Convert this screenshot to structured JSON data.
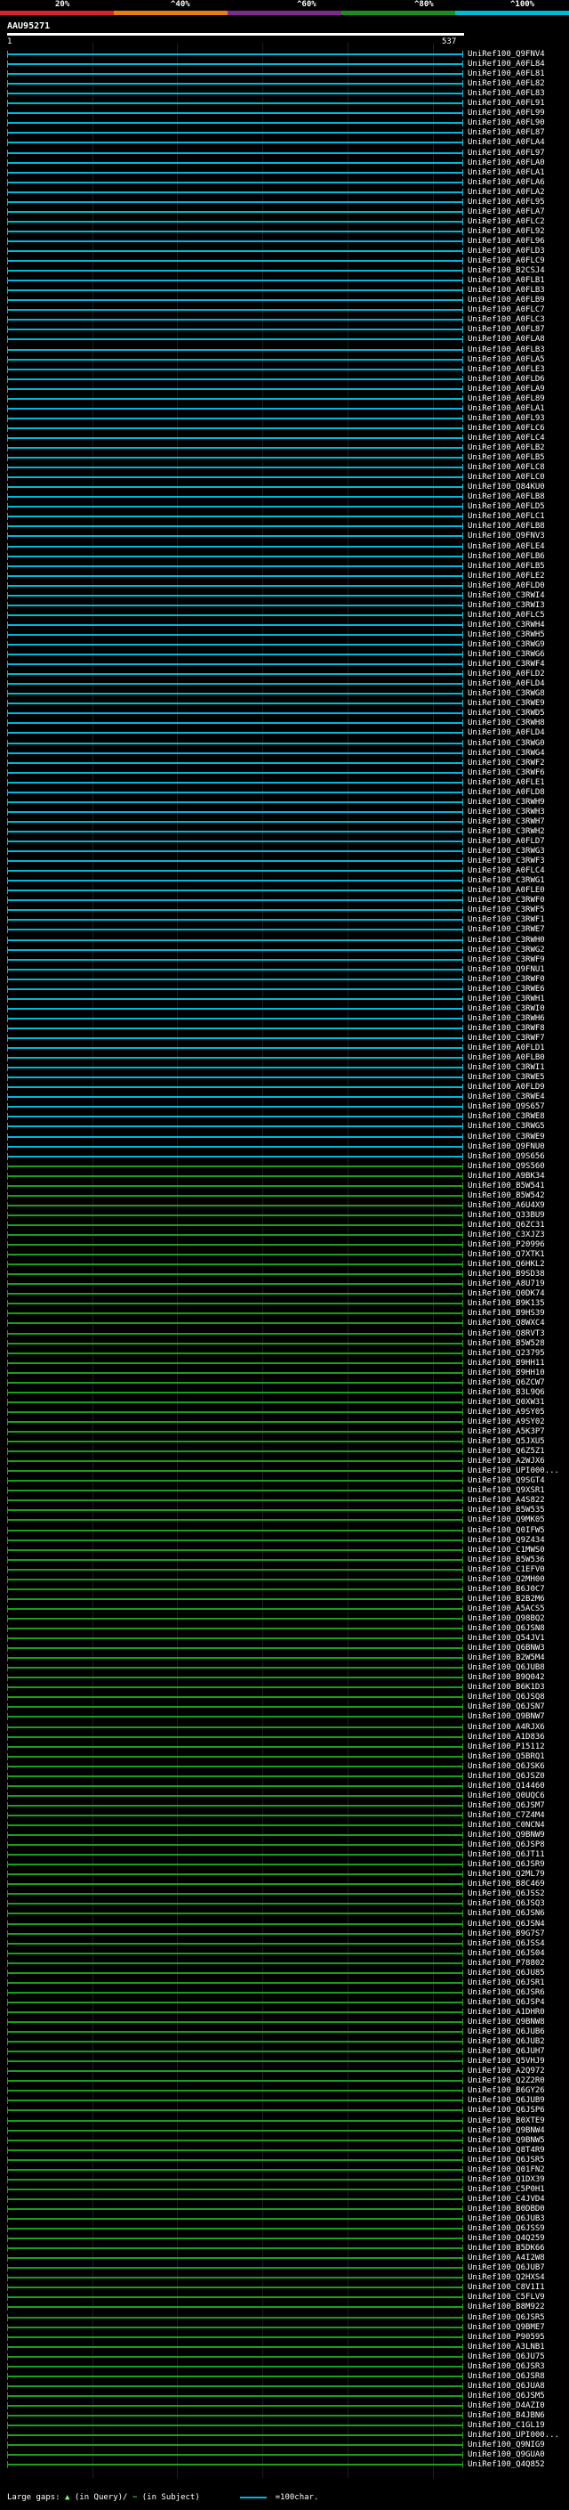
{
  "scale": {
    "labels": [
      "20%",
      "^40%",
      "^60%",
      "^80%",
      "^100%"
    ],
    "colors": [
      "#d8232a",
      "#e87c16",
      "#7d2a8f",
      "#1a8f1a",
      "#00b8d8"
    ]
  },
  "query": {
    "name": "AAU95271",
    "start": "1",
    "end": "537"
  },
  "footer": {
    "large_gaps_label": "Large gaps:",
    "in_query_label": "(in Query)/",
    "in_subject_label": "(in Subject)",
    "legend_label": "=100char."
  },
  "identity_colors": {
    "high": "#00b8d8",
    "mid": "#1a9f1a"
  },
  "hits": [
    {
      "name": "UniRef100_Q9FNV4",
      "c": "high"
    },
    {
      "name": "UniRef100_A0FL84",
      "c": "high"
    },
    {
      "name": "UniRef100_A0FL81",
      "c": "high"
    },
    {
      "name": "UniRef100_A0FL82",
      "c": "high"
    },
    {
      "name": "UniRef100_A0FL83",
      "c": "high"
    },
    {
      "name": "UniRef100_A0FL91",
      "c": "high"
    },
    {
      "name": "UniRef100_A0FL99",
      "c": "high"
    },
    {
      "name": "UniRef100_A0FL90",
      "c": "high"
    },
    {
      "name": "UniRef100_A0FL87",
      "c": "high"
    },
    {
      "name": "UniRef100_A0FLA4",
      "c": "high"
    },
    {
      "name": "UniRef100_A0FL97",
      "c": "high"
    },
    {
      "name": "UniRef100_A0FLA0",
      "c": "high"
    },
    {
      "name": "UniRef100_A0FLA1",
      "c": "high"
    },
    {
      "name": "UniRef100_A0FLA6",
      "c": "high"
    },
    {
      "name": "UniRef100_A0FLA2",
      "c": "high"
    },
    {
      "name": "UniRef100_A0FL95",
      "c": "high"
    },
    {
      "name": "UniRef100_A0FLA7",
      "c": "high"
    },
    {
      "name": "UniRef100_A0FLC2",
      "c": "high"
    },
    {
      "name": "UniRef100_A0FL92",
      "c": "high"
    },
    {
      "name": "UniRef100_A0FL96",
      "c": "high"
    },
    {
      "name": "UniRef100_A0FLD3",
      "c": "high"
    },
    {
      "name": "UniRef100_A0FLC9",
      "c": "high"
    },
    {
      "name": "UniRef100_B2CSJ4",
      "c": "high"
    },
    {
      "name": "UniRef100_A0FLB1",
      "c": "high"
    },
    {
      "name": "UniRef100_A0FLB3",
      "c": "high"
    },
    {
      "name": "UniRef100_A0FLB9",
      "c": "high"
    },
    {
      "name": "UniRef100_A0FLC7",
      "c": "high"
    },
    {
      "name": "UniRef100_A0FLC3",
      "c": "high"
    },
    {
      "name": "UniRef100_A0FL87",
      "c": "high"
    },
    {
      "name": "UniRef100_A0FLA8",
      "c": "high"
    },
    {
      "name": "UniRef100_A0FLB3",
      "c": "high"
    },
    {
      "name": "UniRef100_A0FLA5",
      "c": "high"
    },
    {
      "name": "UniRef100_A0FLE3",
      "c": "high"
    },
    {
      "name": "UniRef100_A0FLD6",
      "c": "high"
    },
    {
      "name": "UniRef100_A0FLA9",
      "c": "high"
    },
    {
      "name": "UniRef100_A0FL89",
      "c": "high"
    },
    {
      "name": "UniRef100_A0FLA1",
      "c": "high"
    },
    {
      "name": "UniRef100_A0FL93",
      "c": "high"
    },
    {
      "name": "UniRef100_A0FLC6",
      "c": "high"
    },
    {
      "name": "UniRef100_A0FLC4",
      "c": "high"
    },
    {
      "name": "UniRef100_A0FLB2",
      "c": "high"
    },
    {
      "name": "UniRef100_A0FLB5",
      "c": "high"
    },
    {
      "name": "UniRef100_A0FLC8",
      "c": "high"
    },
    {
      "name": "UniRef100_A0FLC0",
      "c": "high"
    },
    {
      "name": "UniRef100_Q84KU0",
      "c": "high"
    },
    {
      "name": "UniRef100_A0FLB8",
      "c": "high"
    },
    {
      "name": "UniRef100_A0FLD5",
      "c": "high"
    },
    {
      "name": "UniRef100_A0FLC1",
      "c": "high"
    },
    {
      "name": "UniRef100_A0FLB8",
      "c": "high"
    },
    {
      "name": "UniRef100_Q9FNV3",
      "c": "high"
    },
    {
      "name": "UniRef100_A0FLE4",
      "c": "high"
    },
    {
      "name": "UniRef100_A0FLB6",
      "c": "high"
    },
    {
      "name": "UniRef100_A0FLB5",
      "c": "high"
    },
    {
      "name": "UniRef100_A0FLE2",
      "c": "high"
    },
    {
      "name": "UniRef100_A0FLD0",
      "c": "high"
    },
    {
      "name": "UniRef100_C3RWI4",
      "c": "high"
    },
    {
      "name": "UniRef100_C3RWI3",
      "c": "high"
    },
    {
      "name": "UniRef100_A0FLC5",
      "c": "high"
    },
    {
      "name": "UniRef100_C3RWH4",
      "c": "high"
    },
    {
      "name": "UniRef100_C3RWH5",
      "c": "high"
    },
    {
      "name": "UniRef100_C3RWG9",
      "c": "high"
    },
    {
      "name": "UniRef100_C3RWG6",
      "c": "high"
    },
    {
      "name": "UniRef100_C3RWF4",
      "c": "high"
    },
    {
      "name": "UniRef100_A0FLD2",
      "c": "high"
    },
    {
      "name": "UniRef100_A0FLD4",
      "c": "high"
    },
    {
      "name": "UniRef100_C3RWG8",
      "c": "high"
    },
    {
      "name": "UniRef100_C3RWE9",
      "c": "high"
    },
    {
      "name": "UniRef100_C3RWD5",
      "c": "high"
    },
    {
      "name": "UniRef100_C3RWH8",
      "c": "high"
    },
    {
      "name": "UniRef100_A0FLD4",
      "c": "high"
    },
    {
      "name": "UniRef100_C3RWG0",
      "c": "high"
    },
    {
      "name": "UniRef100_C3RWG4",
      "c": "high"
    },
    {
      "name": "UniRef100_C3RWF2",
      "c": "high"
    },
    {
      "name": "UniRef100_C3RWF6",
      "c": "high"
    },
    {
      "name": "UniRef100_A0FLE1",
      "c": "high"
    },
    {
      "name": "UniRef100_A0FLD8",
      "c": "high"
    },
    {
      "name": "UniRef100_C3RWH9",
      "c": "high"
    },
    {
      "name": "UniRef100_C3RWH3",
      "c": "high"
    },
    {
      "name": "UniRef100_C3RWH7",
      "c": "high"
    },
    {
      "name": "UniRef100_C3RWH2",
      "c": "high"
    },
    {
      "name": "UniRef100_A0FLD7",
      "c": "high"
    },
    {
      "name": "UniRef100_C3RWG3",
      "c": "high"
    },
    {
      "name": "UniRef100_C3RWF3",
      "c": "high"
    },
    {
      "name": "UniRef100_A0FLC4",
      "c": "high"
    },
    {
      "name": "UniRef100_C3RWG1",
      "c": "high"
    },
    {
      "name": "UniRef100_A0FLE0",
      "c": "high"
    },
    {
      "name": "UniRef100_C3RWF0",
      "c": "high"
    },
    {
      "name": "UniRef100_C3RWF5",
      "c": "high"
    },
    {
      "name": "UniRef100_C3RWF1",
      "c": "high"
    },
    {
      "name": "UniRef100_C3RWE7",
      "c": "high"
    },
    {
      "name": "UniRef100_C3RWH0",
      "c": "high"
    },
    {
      "name": "UniRef100_C3RWG2",
      "c": "high"
    },
    {
      "name": "UniRef100_C3RWF9",
      "c": "high"
    },
    {
      "name": "UniRef100_Q9FNU1",
      "c": "high"
    },
    {
      "name": "UniRef100_C3RWF0",
      "c": "high"
    },
    {
      "name": "UniRef100_C3RWE6",
      "c": "high"
    },
    {
      "name": "UniRef100_C3RWH1",
      "c": "high"
    },
    {
      "name": "UniRef100_C3RWI0",
      "c": "high"
    },
    {
      "name": "UniRef100_C3RWH6",
      "c": "high"
    },
    {
      "name": "UniRef100_C3RWF8",
      "c": "high"
    },
    {
      "name": "UniRef100_C3RWF7",
      "c": "high"
    },
    {
      "name": "UniRef100_A0FLD1",
      "c": "high"
    },
    {
      "name": "UniRef100_A0FLB0",
      "c": "high"
    },
    {
      "name": "UniRef100_C3RWI1",
      "c": "high"
    },
    {
      "name": "UniRef100_C3RWE5",
      "c": "high"
    },
    {
      "name": "UniRef100_A0FLD9",
      "c": "high"
    },
    {
      "name": "UniRef100_C3RWE4",
      "c": "high"
    },
    {
      "name": "UniRef100_Q9S657",
      "c": "high"
    },
    {
      "name": "UniRef100_C3RWE8",
      "c": "high"
    },
    {
      "name": "UniRef100_C3RWG5",
      "c": "high"
    },
    {
      "name": "UniRef100_C3RWE9",
      "c": "high"
    },
    {
      "name": "UniRef100_Q9FNU0",
      "c": "high"
    },
    {
      "name": "UniRef100_Q9S656",
      "c": "high"
    },
    {
      "name": "UniRef100_Q9S560",
      "c": "mid"
    },
    {
      "name": "UniRef100_A9BK34",
      "c": "mid"
    },
    {
      "name": "UniRef100_B5W541",
      "c": "mid"
    },
    {
      "name": "UniRef100_B5W542",
      "c": "mid"
    },
    {
      "name": "UniRef100_A6U4X9",
      "c": "mid"
    },
    {
      "name": "UniRef100_Q33BU9",
      "c": "mid"
    },
    {
      "name": "UniRef100_Q6ZC31",
      "c": "mid"
    },
    {
      "name": "UniRef100_C3XJZ3",
      "c": "mid"
    },
    {
      "name": "UniRef100_P20996",
      "c": "mid"
    },
    {
      "name": "UniRef100_Q7XTK1",
      "c": "mid"
    },
    {
      "name": "UniRef100_Q6HKL2",
      "c": "mid"
    },
    {
      "name": "UniRef100_B9SD38",
      "c": "mid"
    },
    {
      "name": "UniRef100_A8U719",
      "c": "mid"
    },
    {
      "name": "UniRef100_Q0DK74",
      "c": "mid"
    },
    {
      "name": "UniRef100_B9K135",
      "c": "mid"
    },
    {
      "name": "UniRef100_B9HS39",
      "c": "mid"
    },
    {
      "name": "UniRef100_Q8WXC4",
      "c": "mid"
    },
    {
      "name": "UniRef100_Q8RVT3",
      "c": "mid"
    },
    {
      "name": "UniRef100_B5W528",
      "c": "mid"
    },
    {
      "name": "UniRef100_Q23795",
      "c": "mid"
    },
    {
      "name": "UniRef100_B9HH11",
      "c": "mid"
    },
    {
      "name": "UniRef100_B9HH10",
      "c": "mid"
    },
    {
      "name": "UniRef100_Q6ZCW7",
      "c": "mid"
    },
    {
      "name": "UniRef100_B3L9Q6",
      "c": "mid"
    },
    {
      "name": "UniRef100_Q0XW31",
      "c": "mid"
    },
    {
      "name": "UniRef100_A9SY05",
      "c": "mid"
    },
    {
      "name": "UniRef100_A9SY02",
      "c": "mid"
    },
    {
      "name": "UniRef100_A5K3P7",
      "c": "mid"
    },
    {
      "name": "UniRef100_Q5JXU5",
      "c": "mid"
    },
    {
      "name": "UniRef100_Q6Z5Z1",
      "c": "mid"
    },
    {
      "name": "UniRef100_A2WJX6",
      "c": "mid"
    },
    {
      "name": "UniRef100_UPI000...",
      "c": "mid"
    },
    {
      "name": "UniRef100_Q9SGT4",
      "c": "mid"
    },
    {
      "name": "UniRef100_Q9XSR1",
      "c": "mid"
    },
    {
      "name": "UniRef100_A4S822",
      "c": "mid"
    },
    {
      "name": "UniRef100_B5W535",
      "c": "mid"
    },
    {
      "name": "UniRef100_Q9MK05",
      "c": "mid"
    },
    {
      "name": "UniRef100_Q0IFW5",
      "c": "mid"
    },
    {
      "name": "UniRef100_Q9Z434",
      "c": "mid"
    },
    {
      "name": "UniRef100_C1MWS0",
      "c": "mid"
    },
    {
      "name": "UniRef100_B5W536",
      "c": "mid"
    },
    {
      "name": "UniRef100_C1EFV0",
      "c": "mid"
    },
    {
      "name": "UniRef100_Q2MH00",
      "c": "mid"
    },
    {
      "name": "UniRef100_B6J0C7",
      "c": "mid"
    },
    {
      "name": "UniRef100_B2B2M6",
      "c": "mid"
    },
    {
      "name": "UniRef100_A5ACS5",
      "c": "mid"
    },
    {
      "name": "UniRef100_Q98BQ2",
      "c": "mid"
    },
    {
      "name": "UniRef100_Q6JSN8",
      "c": "mid"
    },
    {
      "name": "UniRef100_Q54JV1",
      "c": "mid"
    },
    {
      "name": "UniRef100_Q6BNW3",
      "c": "mid"
    },
    {
      "name": "UniRef100_B2W5M4",
      "c": "mid"
    },
    {
      "name": "UniRef100_Q6JUB8",
      "c": "mid"
    },
    {
      "name": "UniRef100_B9Q042",
      "c": "mid"
    },
    {
      "name": "UniRef100_B6K1D3",
      "c": "mid"
    },
    {
      "name": "UniRef100_Q6JSQ8",
      "c": "mid"
    },
    {
      "name": "UniRef100_Q6JSN7",
      "c": "mid"
    },
    {
      "name": "UniRef100_Q9BNW7",
      "c": "mid"
    },
    {
      "name": "UniRef100_A4RJX6",
      "c": "mid"
    },
    {
      "name": "UniRef100_A1D836",
      "c": "mid"
    },
    {
      "name": "UniRef100_P15112",
      "c": "mid"
    },
    {
      "name": "UniRef100_Q5BRQ1",
      "c": "mid"
    },
    {
      "name": "UniRef100_Q6JSK6",
      "c": "mid"
    },
    {
      "name": "UniRef100_Q6JSZ0",
      "c": "mid"
    },
    {
      "name": "UniRef100_Q14460",
      "c": "mid"
    },
    {
      "name": "UniRef100_Q0UQC6",
      "c": "mid"
    },
    {
      "name": "UniRef100_Q6JSM7",
      "c": "mid"
    },
    {
      "name": "UniRef100_C7Z4M4",
      "c": "mid"
    },
    {
      "name": "UniRef100_C0NCN4",
      "c": "mid"
    },
    {
      "name": "UniRef100_Q9BNW9",
      "c": "mid"
    },
    {
      "name": "UniRef100_Q6JSP8",
      "c": "mid"
    },
    {
      "name": "UniRef100_Q6JT11",
      "c": "mid"
    },
    {
      "name": "UniRef100_Q6JSR9",
      "c": "mid"
    },
    {
      "name": "UniRef100_Q2ML79",
      "c": "mid"
    },
    {
      "name": "UniRef100_B8C469",
      "c": "mid"
    },
    {
      "name": "UniRef100_Q6JSS2",
      "c": "mid"
    },
    {
      "name": "UniRef100_Q6JSQ3",
      "c": "mid"
    },
    {
      "name": "UniRef100_Q6JSN6",
      "c": "mid"
    },
    {
      "name": "UniRef100_Q6JSN4",
      "c": "mid"
    },
    {
      "name": "UniRef100_B9G7S7",
      "c": "mid"
    },
    {
      "name": "UniRef100_Q6JSS4",
      "c": "mid"
    },
    {
      "name": "UniRef100_Q6JS04",
      "c": "mid"
    },
    {
      "name": "UniRef100_P78802",
      "c": "mid"
    },
    {
      "name": "UniRef100_Q6JU85",
      "c": "mid"
    },
    {
      "name": "UniRef100_Q6JSR1",
      "c": "mid"
    },
    {
      "name": "UniRef100_Q6JSR6",
      "c": "mid"
    },
    {
      "name": "UniRef100_Q6JSP4",
      "c": "mid"
    },
    {
      "name": "UniRef100_A1DHR0",
      "c": "mid"
    },
    {
      "name": "UniRef100_Q9BNW8",
      "c": "mid"
    },
    {
      "name": "UniRef100_Q6JUB6",
      "c": "mid"
    },
    {
      "name": "UniRef100_Q6JUB2",
      "c": "mid"
    },
    {
      "name": "UniRef100_Q6JUH7",
      "c": "mid"
    },
    {
      "name": "UniRef100_Q5VHJ9",
      "c": "mid"
    },
    {
      "name": "UniRef100_A2Q972",
      "c": "mid"
    },
    {
      "name": "UniRef100_Q2Z2R0",
      "c": "mid"
    },
    {
      "name": "UniRef100_B6GY26",
      "c": "mid"
    },
    {
      "name": "UniRef100_Q6JUB9",
      "c": "mid"
    },
    {
      "name": "UniRef100_Q6JSP6",
      "c": "mid"
    },
    {
      "name": "UniRef100_B0XTE9",
      "c": "mid"
    },
    {
      "name": "UniRef100_Q9BNW4",
      "c": "mid"
    },
    {
      "name": "UniRef100_Q9BNW5",
      "c": "mid"
    },
    {
      "name": "UniRef100_Q8T4R9",
      "c": "mid"
    },
    {
      "name": "UniRef100_Q6JSR5",
      "c": "mid"
    },
    {
      "name": "UniRef100_Q01FN2",
      "c": "mid"
    },
    {
      "name": "UniRef100_Q1DX39",
      "c": "mid"
    },
    {
      "name": "UniRef100_C5P0H1",
      "c": "mid"
    },
    {
      "name": "UniRef100_C4JVD4",
      "c": "mid"
    },
    {
      "name": "UniRef100_B0DBD0",
      "c": "mid"
    },
    {
      "name": "UniRef100_Q6JUB3",
      "c": "mid"
    },
    {
      "name": "UniRef100_Q6JSS9",
      "c": "mid"
    },
    {
      "name": "UniRef100_Q4Q259",
      "c": "mid"
    },
    {
      "name": "UniRef100_B5DK66",
      "c": "mid"
    },
    {
      "name": "UniRef100_A4I2W8",
      "c": "mid"
    },
    {
      "name": "UniRef100_Q6JUB7",
      "c": "mid"
    },
    {
      "name": "UniRef100_Q2HXS4",
      "c": "mid"
    },
    {
      "name": "UniRef100_C8V1I1",
      "c": "mid"
    },
    {
      "name": "UniRef100_C5FLV9",
      "c": "mid"
    },
    {
      "name": "UniRef100_B8M922",
      "c": "mid"
    },
    {
      "name": "UniRef100_Q6JSR5",
      "c": "mid"
    },
    {
      "name": "UniRef100_Q9BME7",
      "c": "mid"
    },
    {
      "name": "UniRef100_P90595",
      "c": "mid"
    },
    {
      "name": "UniRef100_A3LNB1",
      "c": "mid"
    },
    {
      "name": "UniRef100_Q6JU75",
      "c": "mid"
    },
    {
      "name": "UniRef100_Q6JSR3",
      "c": "mid"
    },
    {
      "name": "UniRef100_Q6JSR8",
      "c": "mid"
    },
    {
      "name": "UniRef100_Q6JUA8",
      "c": "mid"
    },
    {
      "name": "UniRef100_Q6JSM5",
      "c": "mid"
    },
    {
      "name": "UniRef100_D4AZI0",
      "c": "mid"
    },
    {
      "name": "UniRef100_B4JBN6",
      "c": "mid"
    },
    {
      "name": "UniRef100_C1GL19",
      "c": "mid"
    },
    {
      "name": "UniRef100_UPI000...",
      "c": "mid"
    },
    {
      "name": "UniRef100_Q9NIG9",
      "c": "mid"
    },
    {
      "name": "UniRef100_Q9GUA0",
      "c": "mid"
    },
    {
      "name": "UniRef100_Q4Q852",
      "c": "mid"
    }
  ]
}
